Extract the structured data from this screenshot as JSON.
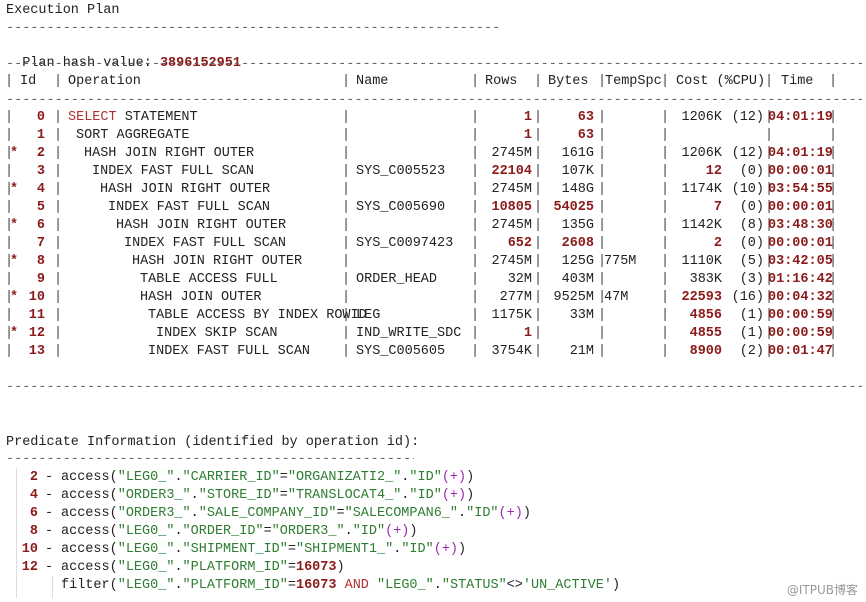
{
  "title": "Execution Plan",
  "hash_label": "Plan hash value:",
  "hash_value": "3896152951",
  "headers": [
    "Id",
    "Operation",
    "Name",
    "Rows",
    "Bytes",
    "TempSpc",
    "Cost (%CPU)",
    "Time"
  ],
  "rows": [
    {
      "star": "",
      "id": "0",
      "op": "SELECT STATEMENT",
      "name": "",
      "rows": "1",
      "bytes": "63",
      "temp": "",
      "cost": "1206K",
      "cpu": "(12)",
      "time": "04:01:19",
      "hl": [
        true,
        true,
        false,
        true
      ]
    },
    {
      "star": "",
      "id": "1",
      "op": "SORT AGGREGATE",
      "name": "",
      "rows": "1",
      "bytes": "63",
      "temp": "",
      "cost": "",
      "cpu": "",
      "time": "",
      "hl": [
        true,
        true,
        false,
        false
      ]
    },
    {
      "star": "*",
      "id": "2",
      "op": "HASH JOIN RIGHT OUTER",
      "name": "",
      "rows": "2745M",
      "bytes": "161G",
      "temp": "",
      "cost": "1206K",
      "cpu": "(12)",
      "time": "04:01:19",
      "hl": [
        false,
        false,
        false,
        true
      ]
    },
    {
      "star": "",
      "id": "3",
      "op": "INDEX FAST FULL SCAN",
      "name": "SYS_C005523",
      "rows": "22104",
      "bytes": "107K",
      "temp": "",
      "cost": "12",
      "cpu": "(0)",
      "time": "00:00:01",
      "hl": [
        true,
        false,
        true,
        true
      ]
    },
    {
      "star": "*",
      "id": "4",
      "op": "HASH JOIN RIGHT OUTER",
      "name": "",
      "rows": "2745M",
      "bytes": "148G",
      "temp": "",
      "cost": "1174K",
      "cpu": "(10)",
      "time": "03:54:55",
      "hl": [
        false,
        false,
        false,
        true
      ]
    },
    {
      "star": "",
      "id": "5",
      "op": "INDEX FAST FULL SCAN",
      "name": "SYS_C005690",
      "rows": "10805",
      "bytes": "54025",
      "temp": "",
      "cost": "7",
      "cpu": "(0)",
      "time": "00:00:01",
      "hl": [
        true,
        true,
        true,
        true
      ]
    },
    {
      "star": "*",
      "id": "6",
      "op": "HASH JOIN RIGHT OUTER",
      "name": "",
      "rows": "2745M",
      "bytes": "135G",
      "temp": "",
      "cost": "1142K",
      "cpu": "(8)",
      "time": "03:48:30",
      "hl": [
        false,
        false,
        false,
        true
      ]
    },
    {
      "star": "",
      "id": "7",
      "op": "INDEX FAST FULL SCAN",
      "name": "SYS_C0097423",
      "rows": "652",
      "bytes": "2608",
      "temp": "",
      "cost": "2",
      "cpu": "(0)",
      "time": "00:00:01",
      "hl": [
        true,
        true,
        true,
        true
      ]
    },
    {
      "star": "*",
      "id": "8",
      "op": "HASH JOIN RIGHT OUTER",
      "name": "",
      "rows": "2745M",
      "bytes": "125G",
      "temp": "775M",
      "cost": "1110K",
      "cpu": "(5)",
      "time": "03:42:05",
      "hl": [
        false,
        false,
        false,
        true
      ]
    },
    {
      "star": "",
      "id": "9",
      "op": "TABLE ACCESS FULL",
      "name": "ORDER_HEAD",
      "rows": "32M",
      "bytes": "403M",
      "temp": "",
      "cost": "383K",
      "cpu": "(3)",
      "time": "01:16:42",
      "hl": [
        false,
        false,
        false,
        true
      ]
    },
    {
      "star": "*",
      "id": "10",
      "op": "HASH JOIN OUTER",
      "name": "",
      "rows": "277M",
      "bytes": "9525M",
      "temp": "47M",
      "cost": "22593",
      "cpu": "(16)",
      "time": "00:04:32",
      "hl": [
        false,
        false,
        true,
        true
      ]
    },
    {
      "star": "",
      "id": "11",
      "op": "TABLE ACCESS BY INDEX ROWID",
      "name": "LEG",
      "rows": "1175K",
      "bytes": "33M",
      "temp": "",
      "cost": "4856",
      "cpu": "(1)",
      "time": "00:00:59",
      "hl": [
        false,
        false,
        true,
        true
      ]
    },
    {
      "star": "*",
      "id": "12",
      "op": "INDEX SKIP SCAN",
      "name": "IND_WRITE_SDC",
      "rows": "1",
      "bytes": "",
      "temp": "",
      "cost": "4855",
      "cpu": "(1)",
      "time": "00:00:59",
      "hl": [
        true,
        false,
        true,
        true
      ]
    },
    {
      "star": "",
      "id": "13",
      "op": "INDEX FAST FULL SCAN",
      "name": "SYS_C005605",
      "rows": "3754K",
      "bytes": "21M",
      "temp": "",
      "cost": "8900",
      "cpu": "(2)",
      "time": "00:01:47",
      "hl": [
        false,
        false,
        true,
        true
      ]
    }
  ],
  "predicate_title": "Predicate Information (identified by operation id):",
  "predicates": [
    {
      "id": "2",
      "text": "access(\"LEG0_\".\"CARRIER_ID\"=\"ORGANIZATI2_\".\"ID\"(+))"
    },
    {
      "id": "4",
      "text": "access(\"ORDER3_\".\"STORE_ID\"=\"TRANSLOCAT4_\".\"ID\"(+))"
    },
    {
      "id": "6",
      "text": "access(\"ORDER3_\".\"SALE_COMPANY_ID\"=\"SALECOMPAN6_\".\"ID\"(+))"
    },
    {
      "id": "8",
      "text": "access(\"LEG0_\".\"ORDER_ID\"=\"ORDER3_\".\"ID\"(+))"
    },
    {
      "id": "10",
      "text": "access(\"LEG0_\".\"SHIPMENT_ID\"=\"SHIPMENT1_\".\"ID\"(+))"
    },
    {
      "id": "12",
      "text": "access(\"LEG0_\".\"PLATFORM_ID\"=16073)"
    },
    {
      "id": "",
      "text": "filter(\"LEG0_\".\"PLATFORM_ID\"=16073 AND \"LEG0_\".\"STATUS\"<>'UN_ACTIVE')"
    }
  ],
  "watermark": "@ITPUB博客"
}
